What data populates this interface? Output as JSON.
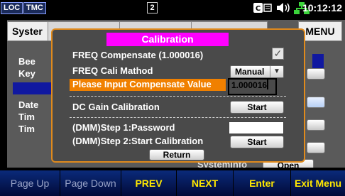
{
  "status": {
    "loc": "LOC",
    "tmc": "TMC",
    "slot": "2",
    "time": "10:12:12"
  },
  "background": {
    "tab_system": "Syster",
    "menu": "MENU",
    "rows": [
      "Bee",
      "Key",
      "Date",
      "Tim",
      "Tim"
    ],
    "partial_text": "SystemInfo",
    "partial_button": "Open"
  },
  "dialog": {
    "title": "Calibration",
    "freq_compensate_label": "FREQ Compensate (1.000016)",
    "freq_compensate_checked": true,
    "freq_cali_method_label": "FREQ Cali Mathod",
    "freq_cali_method_value": "Manual",
    "compensate_input_label": "Please Input Compensate Value",
    "compensate_input_value": "1.000016",
    "dc_gain_label": "DC Gain Calibration",
    "dc_gain_button": "Start",
    "dmm_step1_label": "(DMM)Step 1:Password",
    "dmm_password_value": "",
    "dmm_step2_label": "(DMM)Step 2:Start Calibration",
    "dmm_start_button": "Start",
    "return_button": "Return"
  },
  "softkeys": [
    "Page Up",
    "Page Down",
    "PREV",
    "NEXT",
    "Enter",
    "Exit Menu"
  ],
  "colors": {
    "accent_orange": "#f08000",
    "title_magenta": "#ff00ff",
    "softkey_active": "#ffe800"
  }
}
